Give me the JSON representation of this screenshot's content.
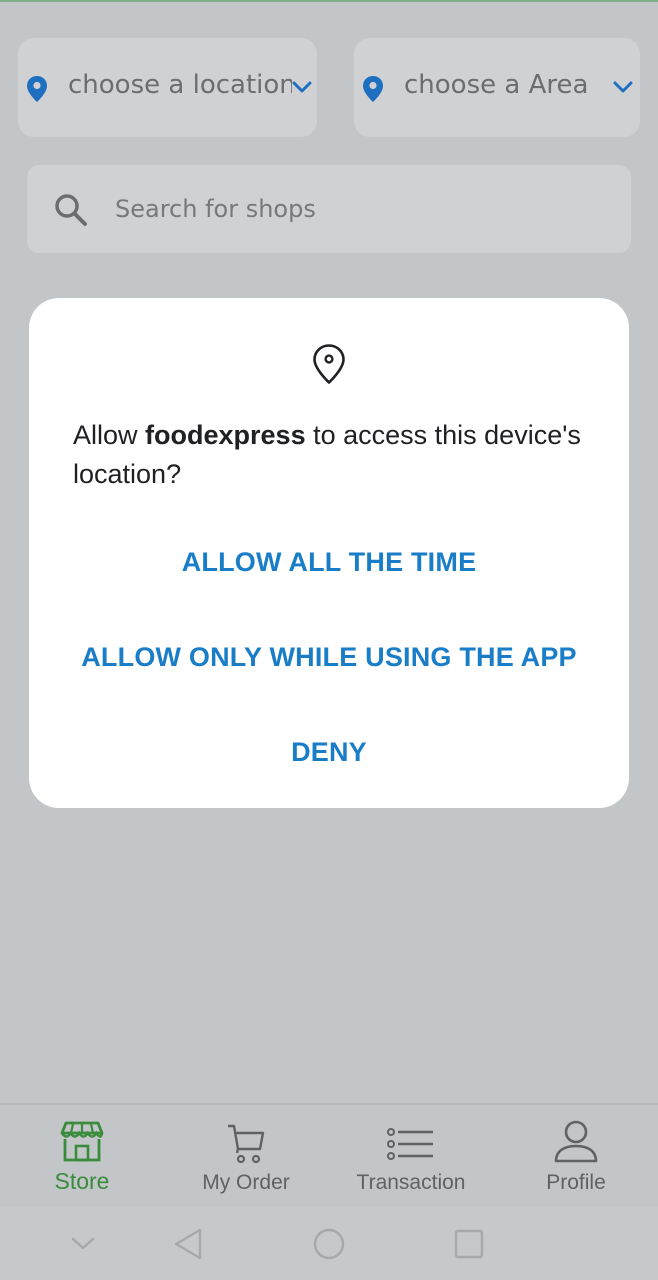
{
  "location_bar": {
    "location_placeholder": "choose a location",
    "area_placeholder": "choose a Area"
  },
  "search": {
    "placeholder": "Search for shops"
  },
  "permission_dialog": {
    "message_prefix": "Allow ",
    "app_name": "foodexpress",
    "message_suffix": " to access this device's location?",
    "allow_all_time": "ALLOW ALL THE TIME",
    "allow_while_using": "ALLOW ONLY WHILE USING THE APP",
    "deny": "DENY"
  },
  "bottom_nav": {
    "items": [
      {
        "label": "Store",
        "icon": "store-icon",
        "active": true
      },
      {
        "label": "My Order",
        "icon": "cart-icon",
        "active": false
      },
      {
        "label": "Transaction",
        "icon": "list-icon",
        "active": false
      },
      {
        "label": "Profile",
        "icon": "person-icon",
        "active": false
      }
    ]
  },
  "system_nav": {
    "icons": [
      "chevron-down-icon",
      "back-icon",
      "home-icon",
      "recents-icon"
    ]
  },
  "colors": {
    "accent_blue": "#1a7dc7",
    "active_green": "#3b8b3d",
    "pin_blue": "#1e6fbf",
    "scrim_background": "#c3c6c9"
  }
}
